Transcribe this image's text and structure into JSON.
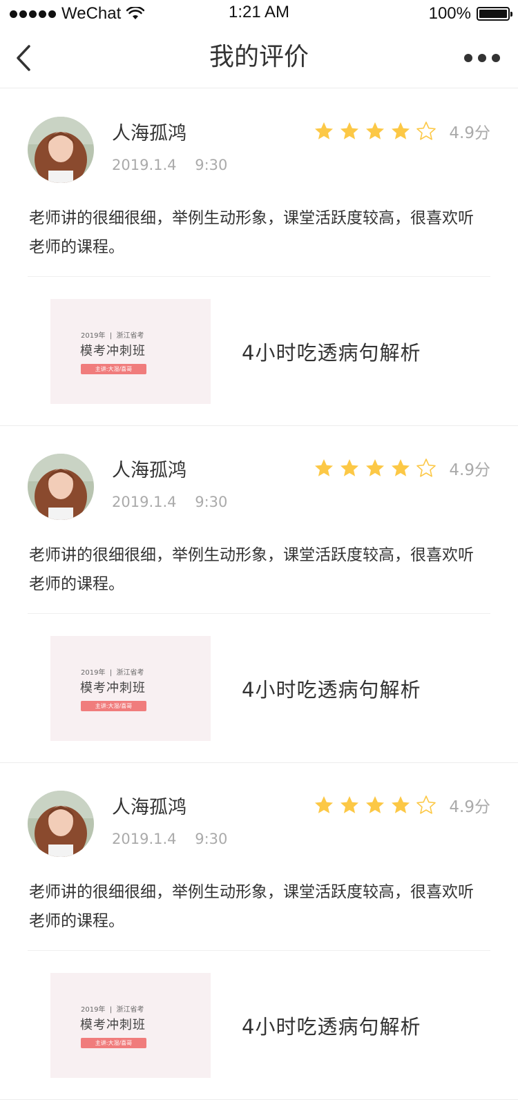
{
  "status_bar": {
    "carrier": "WeChat",
    "time": "1:21 AM",
    "battery": "100%"
  },
  "nav": {
    "title": "我的评价",
    "back_icon": "chevron-left-icon",
    "more_icon": "more-horizontal-icon"
  },
  "colors": {
    "star_filled": "#fcc846",
    "star_empty": "#fcc846",
    "tag": "#f07c7c",
    "muted_text": "#aaaaaa"
  },
  "reviews": [
    {
      "user_name": "人海孤鸿",
      "date": "2019.1.4    9:30",
      "stars_filled": 4,
      "stars_total": 5,
      "score": "4.9分",
      "comment": "老师讲的很细很细，举例生动形象，课堂活跃度较高，很喜欢听老师的课程。",
      "course": {
        "thumb_top": "2019年  |  浙江省考",
        "thumb_title": "模考冲刺班",
        "thumb_tag": "主讲:大湿/喜哥",
        "title": "4小时吃透病句解析"
      }
    },
    {
      "user_name": "人海孤鸿",
      "date": "2019.1.4    9:30",
      "stars_filled": 4,
      "stars_total": 5,
      "score": "4.9分",
      "comment": "老师讲的很细很细，举例生动形象，课堂活跃度较高，很喜欢听老师的课程。",
      "course": {
        "thumb_top": "2019年  |  浙江省考",
        "thumb_title": "模考冲刺班",
        "thumb_tag": "主讲:大湿/喜哥",
        "title": "4小时吃透病句解析"
      }
    },
    {
      "user_name": "人海孤鸿",
      "date": "2019.1.4    9:30",
      "stars_filled": 4,
      "stars_total": 5,
      "score": "4.9分",
      "comment": "老师讲的很细很细，举例生动形象，课堂活跃度较高，很喜欢听老师的课程。",
      "course": {
        "thumb_top": "2019年  |  浙江省考",
        "thumb_title": "模考冲刺班",
        "thumb_tag": "主讲:大湿/喜哥",
        "title": "4小时吃透病句解析"
      }
    }
  ]
}
